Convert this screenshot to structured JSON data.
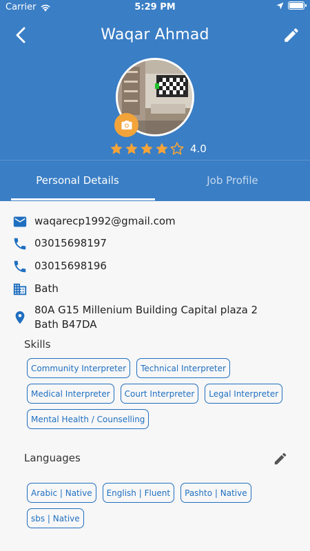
{
  "status_bar": {
    "carrier": "Carrier",
    "time": "5:29 PM",
    "battery_level": 1.0
  },
  "header": {
    "title": "Waqar Ahmad",
    "rating_value": "4.0",
    "rating_stars": 4,
    "background": "#3a7ec5",
    "camera_button_color": "#f2a43a",
    "star_color": "#f2a43a"
  },
  "tabs": [
    {
      "label": "Personal Details",
      "active": true
    },
    {
      "label": "Job Profile",
      "active": false
    }
  ],
  "details": {
    "email": "waqarecp1992@gmail.com",
    "phone_1": "03015698197",
    "phone_2": "03015698196",
    "city": "Bath",
    "address": "80A G15 Millenium Building Capital plaza 2 Bath B47DA"
  },
  "skills": {
    "label": "Skills",
    "items": [
      "Community Interpreter",
      "Technical Interpreter",
      "Medical Interpreter",
      "Court Interpreter",
      "Legal Interpreter",
      "Mental Health / Counselling"
    ]
  },
  "languages": {
    "label": "Languages",
    "items": [
      "Arabic | Native",
      "English | Fluent",
      "Pashto | Native",
      "sbs | Native"
    ]
  },
  "icons": {
    "email": "email-icon",
    "phone": "phone-icon",
    "city": "building-icon",
    "address": "location-pin-icon",
    "accent": "#1f6fc0"
  }
}
